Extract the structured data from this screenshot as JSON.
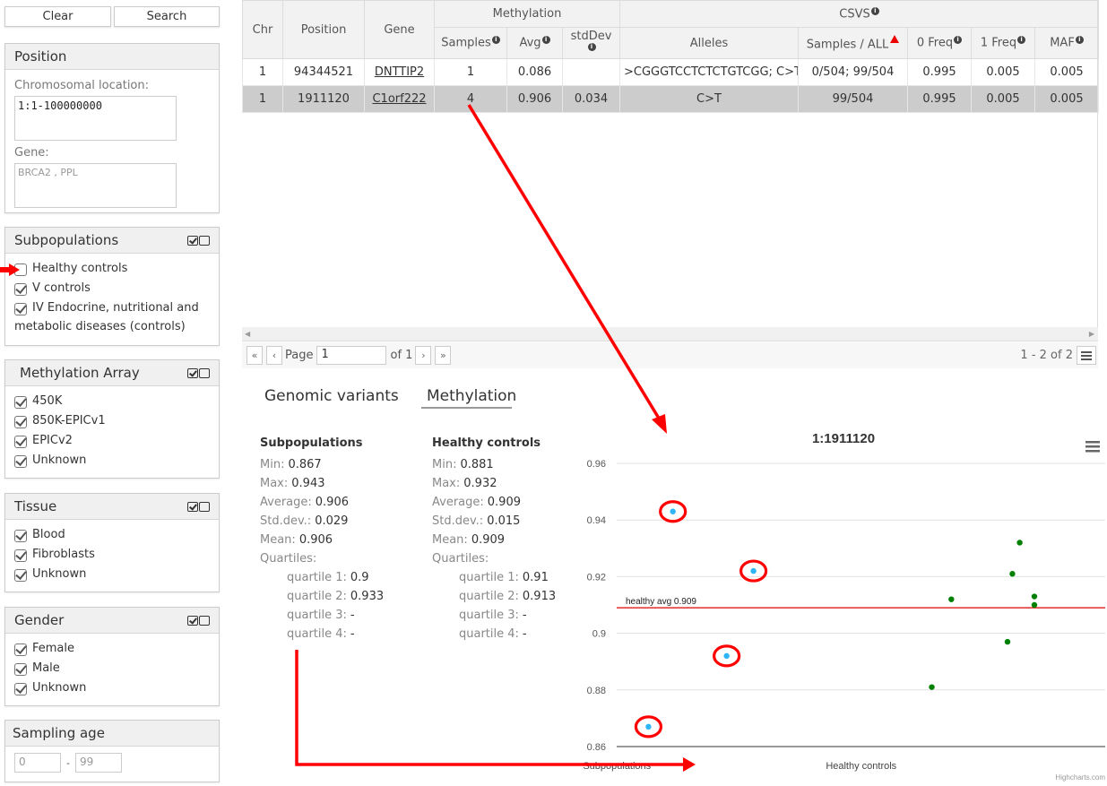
{
  "sidebar": {
    "clear_label": "Clear",
    "search_label": "Search",
    "position": {
      "title": "Position",
      "chrom_label": "Chromosomal location:",
      "chrom_value": "1:1-100000000",
      "gene_label": "Gene:",
      "gene_placeholder": "BRCA2 , PPL"
    },
    "subpopulations": {
      "title": "Subpopulations",
      "items": [
        {
          "label": "Healthy controls",
          "checked": false
        },
        {
          "label": "V controls",
          "checked": true
        },
        {
          "label": "IV Endocrine, nutritional and",
          "label2": "metabolic diseases (controls)",
          "checked": true
        }
      ]
    },
    "methylation_array": {
      "title": "Methylation Array",
      "items": [
        {
          "label": "450K",
          "checked": true
        },
        {
          "label": "850K-EPICv1",
          "checked": true
        },
        {
          "label": "EPICv2",
          "checked": true
        },
        {
          "label": "Unknown",
          "checked": true
        }
      ]
    },
    "tissue": {
      "title": "Tissue",
      "items": [
        {
          "label": "Blood",
          "checked": true
        },
        {
          "label": "Fibroblasts",
          "checked": true
        },
        {
          "label": "Unknown",
          "checked": true
        }
      ]
    },
    "gender": {
      "title": "Gender",
      "items": [
        {
          "label": "Female",
          "checked": true
        },
        {
          "label": "Male",
          "checked": true
        },
        {
          "label": "Unknown",
          "checked": true
        }
      ]
    },
    "sampling_age": {
      "title": "Sampling age",
      "min_placeholder": "0",
      "separator": "-",
      "max_placeholder": "99"
    }
  },
  "table": {
    "headers": {
      "chr": "Chr",
      "position": "Position",
      "gene": "Gene",
      "methylation": "Methylation",
      "csvs": "CSVS",
      "samples": "Samples",
      "avg": "Avg",
      "stddev": "stdDev",
      "alleles": "Alleles",
      "samples_all": "Samples / ALL",
      "freq0": "0 Freq",
      "freq1": "1 Freq",
      "maf": "MAF"
    },
    "rows": [
      {
        "chr": "1",
        "position": "94344521",
        "gene": "DNTTIP2",
        "samples": "1",
        "avg": "0.086",
        "stddev": "",
        "alleles": ">CGGGTCCTCTCTGTCGG; C>T",
        "samples_all": "0/504; 99/504",
        "freq0": "0.995",
        "freq1": "0.005",
        "maf": "0.005"
      },
      {
        "chr": "1",
        "position": "1911120",
        "gene": "C1orf222",
        "samples": "4",
        "avg": "0.906",
        "stddev": "0.034",
        "alleles": "C>T",
        "samples_all": "99/504",
        "freq0": "0.995",
        "freq1": "0.005",
        "maf": "0.005",
        "selected": true
      }
    ]
  },
  "pager": {
    "first": "«",
    "prev": "‹",
    "page_label": "Page",
    "page_value": "1",
    "of_label": "of 1",
    "next": "›",
    "last": "»",
    "summary": "1 - 2 of 2"
  },
  "tabs": [
    {
      "label": "Genomic variants",
      "active": false
    },
    {
      "label": "Methylation",
      "active": true
    }
  ],
  "stats": {
    "subpopulations": {
      "title": "Subpopulations",
      "min": "0.867",
      "max": "0.943",
      "average": "0.906",
      "stddev": "0.029",
      "mean": "0.906",
      "q1": "0.9",
      "q2": "0.933",
      "q3": "-",
      "q4": "-"
    },
    "healthy": {
      "title": "Healthy controls",
      "min": "0.881",
      "max": "0.932",
      "average": "0.909",
      "stddev": "0.015",
      "mean": "0.909",
      "q1": "0.91",
      "q2": "0.913",
      "q3": "-",
      "q4": "-"
    },
    "labels": {
      "min": "Min:",
      "max": "Max:",
      "average": "Average:",
      "stddev": "Std.dev.:",
      "mean": "Mean:",
      "quartiles": "Quartiles:",
      "q1": "quartile 1:",
      "q2": "quartile 2:",
      "q3": "quartile 3:",
      "q4": "quartile 4:"
    }
  },
  "chart_data": {
    "type": "scatter",
    "title": "1:1911120",
    "xlabel": "",
    "ylabel": "",
    "categories": [
      "Subpopulations",
      "Healthy controls"
    ],
    "ylim": [
      0.86,
      0.96
    ],
    "yticks": [
      0.86,
      0.88,
      0.9,
      0.92,
      0.94,
      0.96
    ],
    "ytick_labels": [
      "0.86",
      "0.88",
      "0.9",
      "0.92",
      "0.94",
      "0.96"
    ],
    "grid": true,
    "series": [
      {
        "name": "Subpopulations",
        "color": "#2db5f5",
        "category": 0,
        "values": [
          0.943,
          0.922,
          0.892,
          0.867
        ],
        "jitter": [
          -0.27,
          0.06,
          -0.05,
          -0.37
        ],
        "highlighted": true
      },
      {
        "name": "Healthy controls",
        "color": "#008000",
        "category": 1,
        "values": [
          0.932,
          0.921,
          0.912,
          0.913,
          0.91,
          0.897,
          0.881
        ],
        "jitter": [
          0.15,
          0.12,
          -0.13,
          0.21,
          0.21,
          0.1,
          -0.21
        ]
      }
    ],
    "reference_line": {
      "value": 0.909,
      "label": "healthy avg 0.909",
      "color": "#dd0000"
    },
    "credits": "Highcharts.com"
  },
  "colors": {
    "selected_row": "#cccccc",
    "annotation": "#ff0000",
    "header_bg": "#f2f2f2"
  }
}
